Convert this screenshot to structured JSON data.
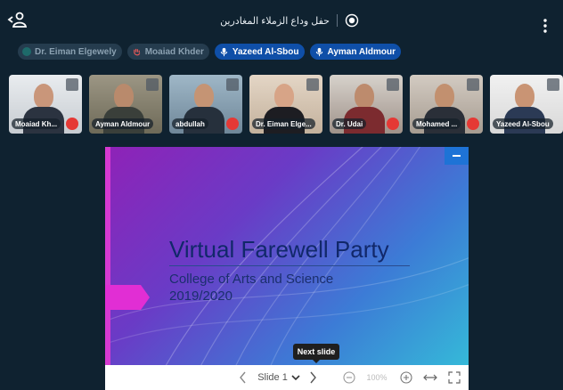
{
  "meeting": {
    "title": "حفل وداع الزملاء المغادرين"
  },
  "chips": [
    {
      "name": "Dr. Eiman Elgewely",
      "state": "muted",
      "icon": "status-dot-icon"
    },
    {
      "name": "Moaiad Khder",
      "state": "muted",
      "icon": "hand-icon"
    },
    {
      "name": "Yazeed Al-Sbou",
      "state": "active",
      "icon": "mic-icon"
    },
    {
      "name": "Ayman Aldmour",
      "state": "active",
      "icon": "mic-icon"
    }
  ],
  "thumbnails": [
    {
      "label": "Moaiad Kh...",
      "muted": true
    },
    {
      "label": "Ayman Aldmour",
      "muted": false
    },
    {
      "label": "abdullah",
      "muted": true
    },
    {
      "label": "Dr. Eiman Elge...",
      "muted": false
    },
    {
      "label": "Dr. Udai",
      "muted": true
    },
    {
      "label": "Mohamed ...",
      "muted": true
    },
    {
      "label": "Yazeed Al-Sbou",
      "muted": false
    }
  ],
  "slide": {
    "title": "Virtual Farewell Party",
    "subtitle": "College of Arts and Science",
    "year": "2019/2020"
  },
  "controls": {
    "slide_label": "Slide 1",
    "zoom": "100%",
    "tooltip": "Next slide"
  },
  "colors": {
    "background": "#0f2230",
    "accent": "#0f4fa8",
    "muted_red": "#e53935"
  }
}
